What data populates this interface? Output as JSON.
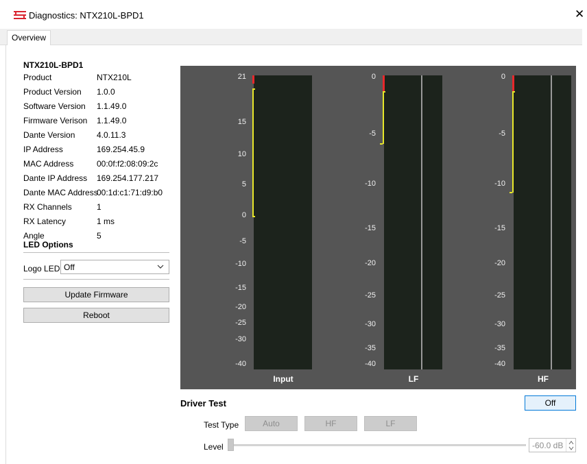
{
  "window": {
    "title": "Diagnostics: NTX210L-BPD1",
    "close_glyph": "✕",
    "icon": "speaker-logo-icon"
  },
  "tabs": [
    {
      "label": "Overview",
      "active": true
    }
  ],
  "device": {
    "name": "NTX210L-BPD1",
    "info": [
      {
        "label": "Product",
        "value": "NTX210L"
      },
      {
        "label": "Product Version",
        "value": "1.0.0"
      },
      {
        "label": "Software Version",
        "value": "1.1.49.0"
      },
      {
        "label": "Firmware Verison",
        "value": "1.1.49.0"
      },
      {
        "label": "Dante Version",
        "value": "4.0.11.3"
      },
      {
        "label": "IP Address",
        "value": "169.254.45.9"
      },
      {
        "label": "MAC Address",
        "value": "00:0f:f2:08:09:2c"
      },
      {
        "label": "Dante IP Address",
        "value": "169.254.177.217"
      },
      {
        "label": "Dante MAC Address",
        "value": "00:1d:c1:71:d9:b0"
      },
      {
        "label": "RX Channels",
        "value": "1"
      },
      {
        "label": "RX Latency",
        "value": "1 ms"
      },
      {
        "label": "Angle",
        "value": "5"
      }
    ]
  },
  "led_options": {
    "title": "LED Options",
    "logo_led_label": "Logo LED",
    "logo_led_value": "Off"
  },
  "actions": {
    "update_firmware": "Update Firmware",
    "reboot": "Reboot"
  },
  "meters": [
    {
      "label": "Input",
      "ticks": [
        "21",
        "15",
        "10",
        "5",
        "0",
        "-5",
        "-10",
        "-15",
        "-20",
        "-25",
        "-30",
        "-40"
      ]
    },
    {
      "label": "LF",
      "ticks": [
        "0",
        "-5",
        "-10",
        "-15",
        "-20",
        "-25",
        "-30",
        "-35",
        "-40"
      ]
    },
    {
      "label": "HF",
      "ticks": [
        "0",
        "-5",
        "-10",
        "-15",
        "-20",
        "-25",
        "-30",
        "-35",
        "-40"
      ]
    }
  ],
  "colors": {
    "meter_bg": "#555555",
    "bar_bg": "#1c231c",
    "peak": "#e8272b",
    "level": "#e8e82a",
    "accent": "#0078d7"
  },
  "driver_test": {
    "title": "Driver Test",
    "toggle_label": "Off",
    "test_type_label": "Test Type",
    "test_types": [
      "Auto",
      "HF",
      "LF"
    ],
    "level_label": "Level",
    "level_value": "-60.0 dB"
  }
}
